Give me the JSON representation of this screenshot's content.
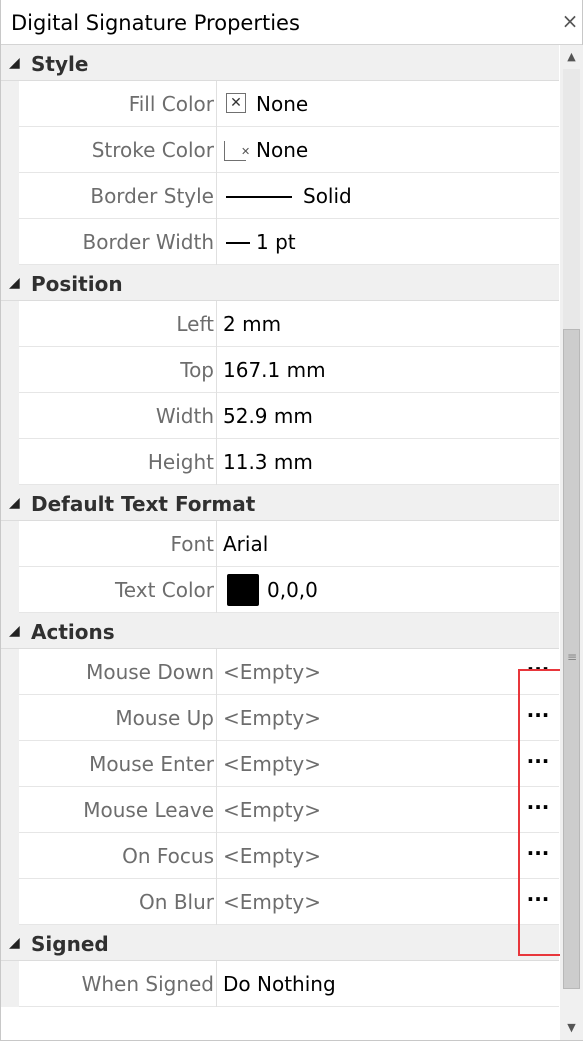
{
  "panel": {
    "title": "Digital Signature Properties",
    "close_glyph": "×"
  },
  "categories": {
    "style": "Style",
    "position": "Position",
    "default_text_format": "Default Text Format",
    "actions": "Actions",
    "signed": "Signed"
  },
  "style": {
    "fill_color": {
      "name": "Fill Color",
      "value": "None"
    },
    "stroke_color": {
      "name": "Stroke Color",
      "value": "None"
    },
    "border_style": {
      "name": "Border Style",
      "value": "Solid"
    },
    "border_width": {
      "name": "Border Width",
      "value": "1 pt"
    }
  },
  "position": {
    "left": {
      "name": "Left",
      "value": "2 mm"
    },
    "top": {
      "name": "Top",
      "value": "167.1 mm"
    },
    "width": {
      "name": "Width",
      "value": "52.9 mm"
    },
    "height": {
      "name": "Height",
      "value": "11.3 mm"
    }
  },
  "default_text_format": {
    "font": {
      "name": "Font",
      "value": "Arial"
    },
    "text_color": {
      "name": "Text Color",
      "value": "0,0,0",
      "swatch": "#000000"
    }
  },
  "actions": {
    "button_label": "···",
    "mouse_down": {
      "name": "Mouse Down",
      "value": "<Empty>"
    },
    "mouse_up": {
      "name": "Mouse Up",
      "value": "<Empty>"
    },
    "mouse_enter": {
      "name": "Mouse Enter",
      "value": "<Empty>"
    },
    "mouse_leave": {
      "name": "Mouse Leave",
      "value": "<Empty>"
    },
    "on_focus": {
      "name": "On Focus",
      "value": "<Empty>"
    },
    "on_blur": {
      "name": "On Blur",
      "value": "<Empty>"
    }
  },
  "signed": {
    "when_signed": {
      "name": "When Signed",
      "value": "Do Nothing"
    }
  },
  "colors": {
    "highlight": "#e8363b",
    "category_bg": "#f0f0f0"
  }
}
